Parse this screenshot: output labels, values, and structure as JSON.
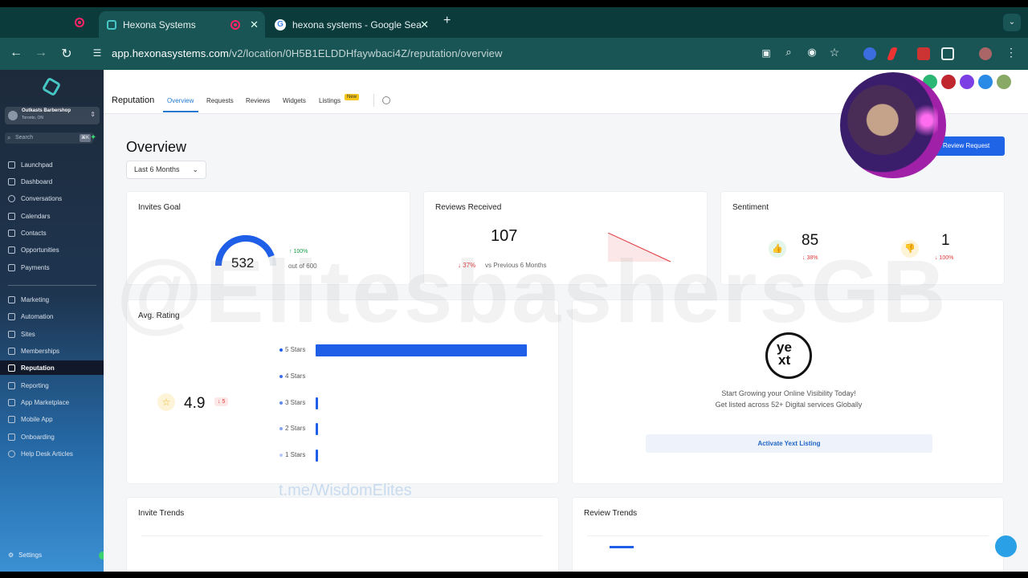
{
  "browser": {
    "tabs": [
      {
        "label": "Hexona Systems",
        "active": true
      },
      {
        "label": "hexona systems - Google Sea",
        "active": false
      }
    ],
    "url_host": "app.hexonasystems.com",
    "url_path": "/v2/location/0H5B1ELDDHfaywbaci4Z/reputation/overview"
  },
  "sidebar": {
    "account_name": "Outkasts Barbershop",
    "account_location": "Toronto, ON",
    "search_placeholder": "Search",
    "search_shortcut": "⌘K",
    "items": [
      {
        "label": "Launchpad"
      },
      {
        "label": "Dashboard"
      },
      {
        "label": "Conversations"
      },
      {
        "label": "Calendars"
      },
      {
        "label": "Contacts"
      },
      {
        "label": "Opportunities"
      },
      {
        "label": "Payments"
      },
      {
        "label": "Marketing"
      },
      {
        "label": "Automation"
      },
      {
        "label": "Sites"
      },
      {
        "label": "Memberships"
      },
      {
        "label": "Reputation",
        "active": true
      },
      {
        "label": "Reporting"
      },
      {
        "label": "App Marketplace"
      },
      {
        "label": "Mobile App"
      },
      {
        "label": "Onboarding"
      },
      {
        "label": "Help Desk Articles"
      }
    ],
    "settings_label": "Settings"
  },
  "subnav": {
    "title": "Reputation",
    "tabs": [
      "Overview",
      "Requests",
      "Reviews",
      "Widgets",
      "Listings"
    ],
    "new_badge": "New"
  },
  "page": {
    "title": "Overview",
    "range": "Last 6 Months",
    "review_request_button": "Review Request"
  },
  "invites": {
    "title": "Invites Goal",
    "value": "532",
    "change": "100%",
    "out_of": "out of 600",
    "progress": 0.887
  },
  "reviews_received": {
    "title": "Reviews Received",
    "value": "107",
    "change": "37%",
    "compare": "vs Previous 6 Months"
  },
  "sentiment": {
    "title": "Sentiment",
    "positive": "85",
    "positive_change": "38%",
    "negative": "1",
    "negative_change": "100%"
  },
  "rating": {
    "title": "Avg. Rating",
    "value": "4.9",
    "change": "5",
    "rows": [
      {
        "label": "5 Stars",
        "fraction": 1.0
      },
      {
        "label": "4 Stars",
        "fraction": 0
      },
      {
        "label": "3 Stars",
        "fraction": 0.01
      },
      {
        "label": "2 Stars",
        "fraction": 0.01
      },
      {
        "label": "1 Stars",
        "fraction": 0.01
      }
    ]
  },
  "yext": {
    "line1": "Start Growing your Online Visibility Today!",
    "line2": "Get listed across 52+ Digital services Globally",
    "button": "Activate Yext Listing"
  },
  "sections": {
    "invite_trends": "Invite Trends",
    "review_trends": "Review Trends"
  },
  "overlays": {
    "watermark": "@ElitesbashersGB",
    "telegram": "t.me/WisdomElites"
  },
  "colors": {
    "accent": "#1f5fe8",
    "browser_chrome": "#0c3b3c"
  }
}
